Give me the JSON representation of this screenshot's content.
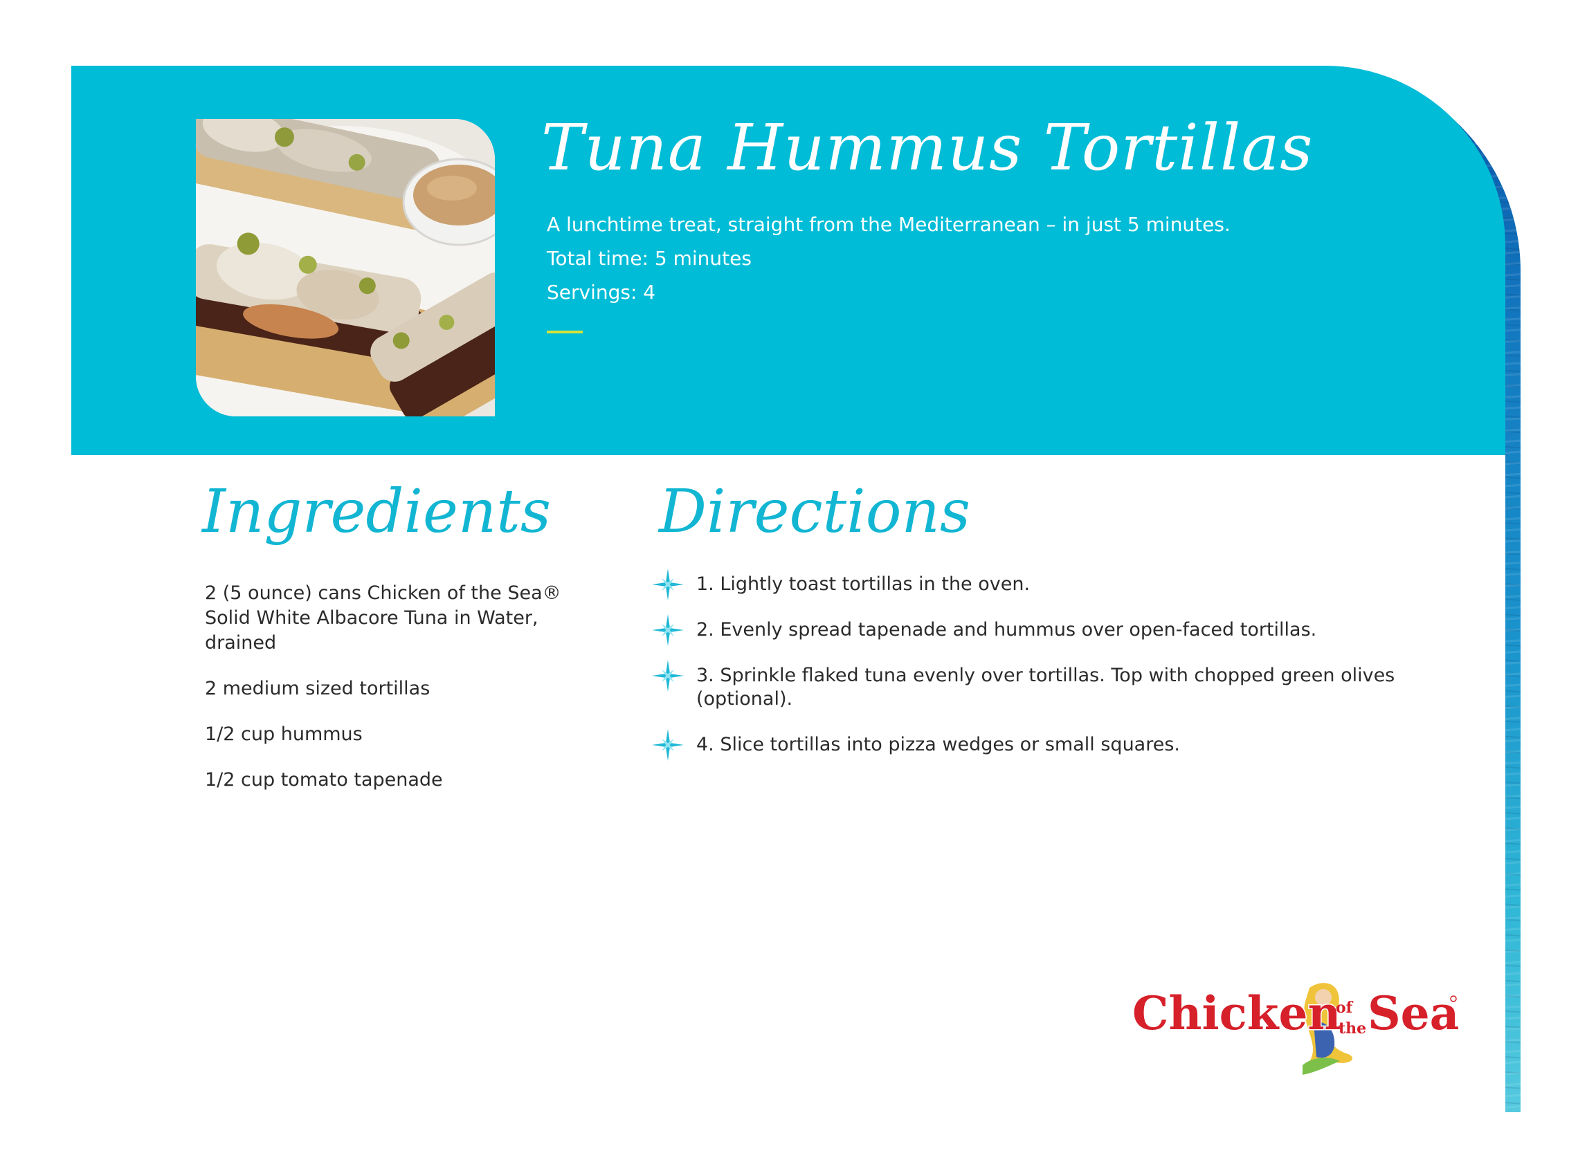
{
  "recipe": {
    "title": "Tuna Hummus Tortillas",
    "description": "A lunchtime treat, straight from the Mediterranean – in just 5 minutes.",
    "total_time": "Total time: 5 minutes",
    "servings": "Servings: 4"
  },
  "ingredients": {
    "heading": "Ingredients",
    "items": [
      "2 (5 ounce) cans Chicken of the Sea® Solid White Albacore Tuna in Water, drained",
      "2 medium sized tortillas",
      "1/2 cup hummus",
      "1/2 cup tomato tapenade"
    ]
  },
  "directions": {
    "heading": "Directions",
    "steps": [
      "1. Lightly toast tortillas in the oven.",
      "2. Evenly spread tapenade and hummus over open-faced tortillas.",
      "3. Sprinkle flaked tuna evenly over tortillas. Top with chopped green olives (optional).",
      "4. Slice tortillas into pizza wedges or small squares."
    ]
  },
  "brand": {
    "logo_text": "Chicken of the Sea",
    "logo_word_1": "Chicken",
    "logo_word_of": "of",
    "logo_word_the": "the",
    "logo_word_2": "Sea"
  },
  "colors": {
    "header": "#00bcd6",
    "heading_text": "#12b6d2",
    "accent_line": "#d6e23a",
    "logo_red": "#d6202a",
    "sparkle": "#1fb8d6"
  },
  "icons": {
    "step_marker": "sparkle-icon"
  }
}
